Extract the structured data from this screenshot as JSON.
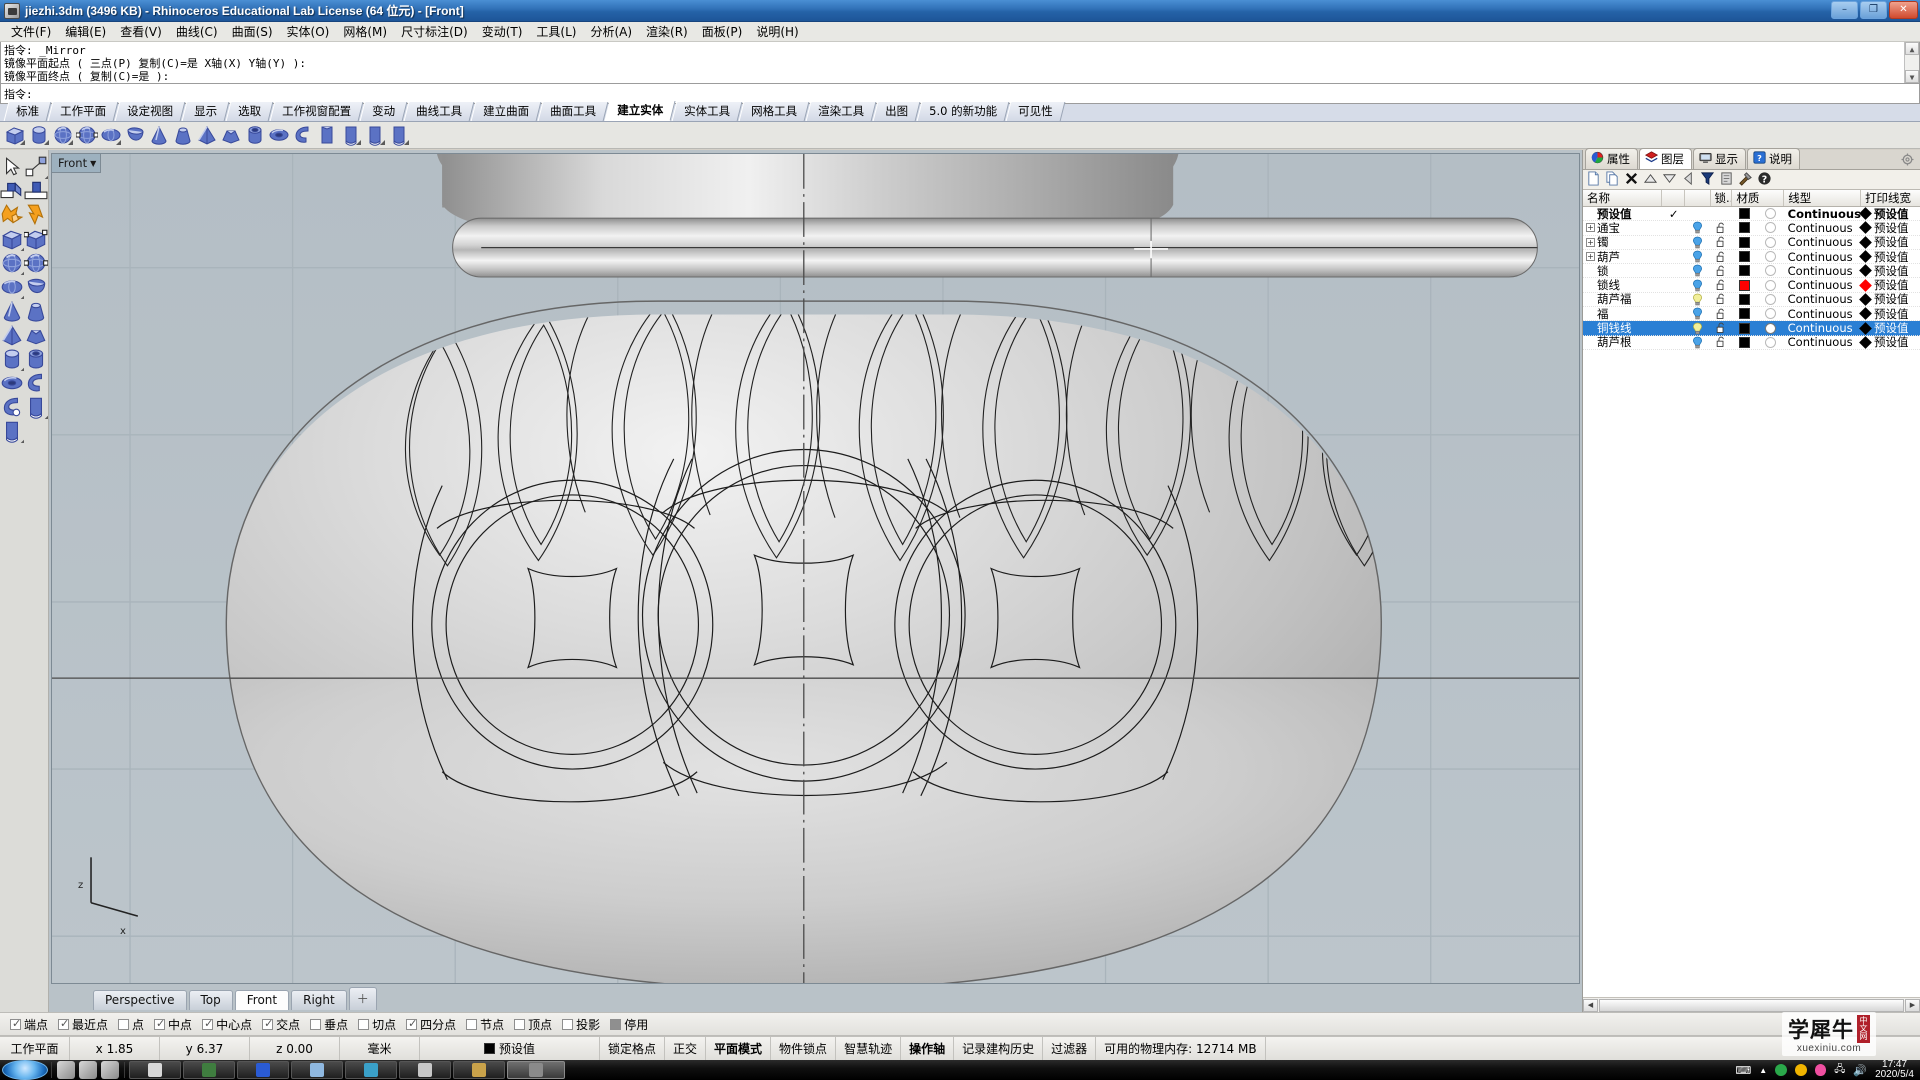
{
  "window": {
    "title": "jiezhi.3dm (3496 KB) - Rhinoceros Educational Lab License (64 位元) - [Front]",
    "minimize": "–",
    "maximize": "❐",
    "close": "✕"
  },
  "menubar": {
    "items": [
      {
        "label": "文件(F)"
      },
      {
        "label": "编辑(E)"
      },
      {
        "label": "查看(V)"
      },
      {
        "label": "曲线(C)"
      },
      {
        "label": "曲面(S)"
      },
      {
        "label": "实体(O)"
      },
      {
        "label": "网格(M)"
      },
      {
        "label": "尺寸标注(D)"
      },
      {
        "label": "变动(T)"
      },
      {
        "label": "工具(L)"
      },
      {
        "label": "分析(A)"
      },
      {
        "label": "渲染(R)"
      },
      {
        "label": "面板(P)"
      },
      {
        "label": "说明(H)"
      }
    ]
  },
  "command": {
    "history": [
      "指令: _Mirror",
      "镜像平面起点 ( 三点(P)  复制(C)=是  X轴(X)  Y轴(Y) ):",
      "镜像平面终点 ( 复制(C)=是 ):"
    ],
    "prompt": "指令:",
    "input_value": ""
  },
  "toolbar_tabs": {
    "items": [
      {
        "label": "标准",
        "active": false
      },
      {
        "label": "工作平面",
        "active": false
      },
      {
        "label": "设定视图",
        "active": false
      },
      {
        "label": "显示",
        "active": false
      },
      {
        "label": "选取",
        "active": false
      },
      {
        "label": "工作视窗配置",
        "active": false
      },
      {
        "label": "变动",
        "active": false
      },
      {
        "label": "曲线工具",
        "active": false
      },
      {
        "label": "建立曲面",
        "active": false
      },
      {
        "label": "曲面工具",
        "active": false
      },
      {
        "label": "建立实体",
        "active": true
      },
      {
        "label": "实体工具",
        "active": false
      },
      {
        "label": "网格工具",
        "active": false
      },
      {
        "label": "渲染工具",
        "active": false
      },
      {
        "label": "出图",
        "active": false
      },
      {
        "label": "5.0 的新功能",
        "active": false
      },
      {
        "label": "可见性",
        "active": false
      }
    ]
  },
  "icon_toolbar": {
    "items": [
      {
        "name": "box-icon"
      },
      {
        "name": "cylinder-icon"
      },
      {
        "name": "sphere-icon"
      },
      {
        "name": "sphere-3point-icon"
      },
      {
        "name": "ellipsoid-icon"
      },
      {
        "name": "paraboloid-icon"
      },
      {
        "name": "cone-icon"
      },
      {
        "name": "truncated-cone-icon"
      },
      {
        "name": "pyramid-icon"
      },
      {
        "name": "truncated-pyramid-icon"
      },
      {
        "name": "tube-icon"
      },
      {
        "name": "torus-icon"
      },
      {
        "name": "pipe-icon"
      },
      {
        "name": "pipe-flat-icon"
      },
      {
        "name": "pipe-round-icon"
      },
      {
        "name": "slab-icon"
      },
      {
        "name": "surface-extrude-icon"
      }
    ]
  },
  "left_toolbar": {
    "items": [
      {
        "name": "select-arrow-icon"
      },
      {
        "name": "select-window-icon"
      },
      {
        "name": "extrude-curve-icon"
      },
      {
        "name": "extrude-straight-icon"
      },
      {
        "name": "boolean-union-icon"
      },
      {
        "name": "boolean-split-icon"
      },
      {
        "name": "box-icon"
      },
      {
        "name": "box-corner-icon"
      },
      {
        "name": "sphere-icon"
      },
      {
        "name": "sphere-3point-icon"
      },
      {
        "name": "ellipsoid-icon"
      },
      {
        "name": "paraboloid-icon"
      },
      {
        "name": "cone-icon"
      },
      {
        "name": "truncated-cone-icon"
      },
      {
        "name": "pyramid-icon"
      },
      {
        "name": "truncated-pyramid-icon"
      },
      {
        "name": "cylinder-icon"
      },
      {
        "name": "tube-icon"
      },
      {
        "name": "torus-icon"
      },
      {
        "name": "pipe-icon"
      },
      {
        "name": "pipe2-icon"
      },
      {
        "name": "slab-icon"
      },
      {
        "name": "surface-extrude-icon"
      }
    ]
  },
  "viewport": {
    "label": "Front",
    "axis_x": "x",
    "axis_z": "z",
    "tabs": [
      {
        "label": "Perspective",
        "active": false
      },
      {
        "label": "Top",
        "active": false
      },
      {
        "label": "Front",
        "active": true
      },
      {
        "label": "Right",
        "active": false
      },
      {
        "label": "＋",
        "active": false
      }
    ]
  },
  "right_panel": {
    "tabs": [
      {
        "label": "属性",
        "icon": "properties-icon",
        "active": false
      },
      {
        "label": "图层",
        "icon": "layers-icon",
        "active": true
      },
      {
        "label": "显示",
        "icon": "display-icon",
        "active": false
      },
      {
        "label": "说明",
        "icon": "help-icon",
        "active": false
      }
    ],
    "gear": "gear-icon",
    "toolbar": [
      {
        "name": "new-layer-icon"
      },
      {
        "name": "copy-layer-icon"
      },
      {
        "name": "delete-layer-icon"
      },
      {
        "name": "move-up-icon"
      },
      {
        "name": "move-down-icon"
      },
      {
        "name": "prev-icon"
      },
      {
        "name": "filter-icon"
      },
      {
        "name": "properties-icon"
      },
      {
        "name": "tools-icon"
      },
      {
        "name": "help-icon"
      }
    ],
    "columns": [
      "名称",
      "",
      "",
      "锁...",
      "材质",
      "线型",
      "",
      "打印线宽"
    ],
    "layers": [
      {
        "name": "预设值",
        "expandable": false,
        "current": true,
        "bulb": "none",
        "lock": "none",
        "color": "#000000",
        "material": false,
        "linetype": "Continuous",
        "printwidth": "预设值",
        "pw_color": "#000000",
        "selected": false,
        "bold": true
      },
      {
        "name": "通宝",
        "expandable": true,
        "current": false,
        "bulb": "on",
        "lock": "open",
        "color": "#000000",
        "material": false,
        "linetype": "Continuous",
        "printwidth": "预设值",
        "pw_color": "#000000",
        "selected": false,
        "bold": false
      },
      {
        "name": "镯",
        "expandable": true,
        "current": false,
        "bulb": "on",
        "lock": "open",
        "color": "#000000",
        "material": false,
        "linetype": "Continuous",
        "printwidth": "预设值",
        "pw_color": "#000000",
        "selected": false,
        "bold": false
      },
      {
        "name": "葫芦",
        "expandable": true,
        "current": false,
        "bulb": "on",
        "lock": "open",
        "color": "#000000",
        "material": false,
        "linetype": "Continuous",
        "printwidth": "预设值",
        "pw_color": "#000000",
        "selected": false,
        "bold": false
      },
      {
        "name": "锁",
        "expandable": false,
        "current": false,
        "bulb": "on",
        "lock": "open",
        "color": "#000000",
        "material": false,
        "linetype": "Continuous",
        "printwidth": "预设值",
        "pw_color": "#000000",
        "selected": false,
        "bold": false
      },
      {
        "name": "锁线",
        "expandable": false,
        "current": false,
        "bulb": "on",
        "lock": "open",
        "color": "#ff0000",
        "material": false,
        "linetype": "Continuous",
        "printwidth": "预设值",
        "pw_color": "#ff0000",
        "selected": false,
        "bold": false
      },
      {
        "name": "葫芦福",
        "expandable": false,
        "current": false,
        "bulb": "off",
        "lock": "open",
        "color": "#000000",
        "material": false,
        "linetype": "Continuous",
        "printwidth": "预设值",
        "pw_color": "#000000",
        "selected": false,
        "bold": false
      },
      {
        "name": "福",
        "expandable": false,
        "current": false,
        "bulb": "on",
        "lock": "open",
        "color": "#000000",
        "material": false,
        "linetype": "Continuous",
        "printwidth": "预设值",
        "pw_color": "#000000",
        "selected": false,
        "bold": false
      },
      {
        "name": "铜钱线",
        "expandable": false,
        "current": false,
        "bulb": "off",
        "lock": "open",
        "color": "#000000",
        "material": true,
        "linetype": "Continuous",
        "printwidth": "预设值",
        "pw_color": "#000000",
        "selected": true,
        "bold": false
      },
      {
        "name": "葫芦根",
        "expandable": false,
        "current": false,
        "bulb": "on",
        "lock": "open",
        "color": "#000000",
        "material": false,
        "linetype": "Continuous",
        "printwidth": "预设值",
        "pw_color": "#000000",
        "selected": false,
        "bold": false
      }
    ]
  },
  "osnap": {
    "items": [
      {
        "label": "端点",
        "checked": true
      },
      {
        "label": "最近点",
        "checked": true
      },
      {
        "label": "点",
        "checked": false
      },
      {
        "label": "中点",
        "checked": true
      },
      {
        "label": "中心点",
        "checked": true
      },
      {
        "label": "交点",
        "checked": true
      },
      {
        "label": "垂点",
        "checked": false
      },
      {
        "label": "切点",
        "checked": false
      },
      {
        "label": "四分点",
        "checked": true
      },
      {
        "label": "节点",
        "checked": false
      },
      {
        "label": "顶点",
        "checked": false
      },
      {
        "label": "投影",
        "checked": false
      },
      {
        "label": "停用",
        "checked": false,
        "disabled_style": true
      }
    ]
  },
  "statusbar": {
    "cplane_label": "工作平面",
    "x": "x 1.85",
    "y": "y 6.37",
    "z": "z 0.00",
    "units": "毫米",
    "layer": "预设值",
    "layer_color": "#000000",
    "toggles": [
      {
        "label": "锁定格点",
        "on": false
      },
      {
        "label": "正交",
        "on": false
      },
      {
        "label": "平面模式",
        "on": true
      },
      {
        "label": "物件锁点",
        "on": false
      },
      {
        "label": "智慧轨迹",
        "on": false
      },
      {
        "label": "操作轴",
        "on": true
      },
      {
        "label": "记录建构历史",
        "on": false
      },
      {
        "label": "过滤器",
        "on": false
      }
    ],
    "memory": "可用的物理内存: 12714 MB"
  },
  "taskbar": {
    "start": "start-orb-icon",
    "quicklaunch": [
      {
        "name": "ie-icon"
      },
      {
        "name": "explorer-icon"
      },
      {
        "name": "media-icon"
      }
    ],
    "apps": [
      {
        "name": "chrome-icon",
        "active": false
      },
      {
        "name": "rhino-app-icon",
        "active": false
      },
      {
        "name": "folder-icon",
        "active": false
      },
      {
        "name": "window-icon",
        "active": false
      },
      {
        "name": "s-app-icon",
        "active": false
      },
      {
        "name": "calc-icon",
        "active": false
      },
      {
        "name": "images-icon",
        "active": false
      },
      {
        "name": "rhino-window-icon",
        "active": true
      }
    ],
    "tray": [
      {
        "name": "keyboard-icon"
      },
      {
        "name": "show-hidden-icon"
      },
      {
        "name": "ie-tray-icon"
      },
      {
        "name": "update-icon"
      },
      {
        "name": "qq-icon"
      },
      {
        "name": "network-icon"
      },
      {
        "name": "volume-icon"
      }
    ],
    "clock_time": "17:47",
    "clock_date": "2020/5/4"
  },
  "watermark": {
    "cn": "学犀牛",
    "badge_line1": "中",
    "badge_line2": "文",
    "badge_line3": "网",
    "url": "xuexiniu.com"
  }
}
